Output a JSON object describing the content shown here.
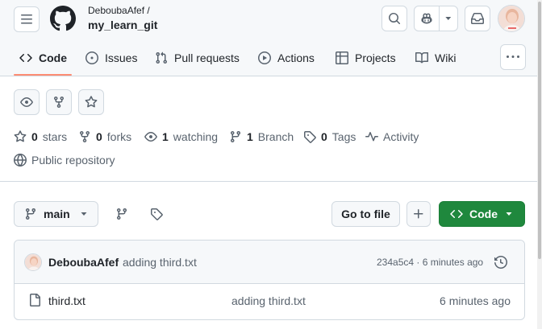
{
  "header": {
    "owner": "DeboubaAfef /",
    "repo": "my_learn_git"
  },
  "tabs": [
    {
      "label": "Code",
      "icon": "code-icon",
      "active": true
    },
    {
      "label": "Issues",
      "icon": "issue-icon"
    },
    {
      "label": "Pull requests",
      "icon": "pull-request-icon"
    },
    {
      "label": "Actions",
      "icon": "play-icon"
    },
    {
      "label": "Projects",
      "icon": "table-icon"
    },
    {
      "label": "Wiki",
      "icon": "book-icon"
    }
  ],
  "stats": {
    "stars_count": "0",
    "stars_label": "stars",
    "forks_count": "0",
    "forks_label": "forks",
    "watching_count": "1",
    "watching_label": "watching",
    "branch_count": "1",
    "branch_label": "Branch",
    "tags_count": "0",
    "tags_label": "Tags",
    "activity_label": "Activity",
    "visibility": "Public repository"
  },
  "toolbar": {
    "branch": "main",
    "go_to_file": "Go to file",
    "code_button": "Code"
  },
  "commit": {
    "author": "DeboubaAfef",
    "message": "adding third.txt",
    "info": "234a5c4 · 6 minutes ago"
  },
  "files": [
    {
      "name": "third.txt",
      "message": "adding third.txt",
      "age": "6 minutes ago"
    }
  ],
  "colors": {
    "accent": "#fd8c73",
    "primary_button": "#1f883d",
    "border": "#d1d9e0",
    "muted": "#59636e"
  }
}
